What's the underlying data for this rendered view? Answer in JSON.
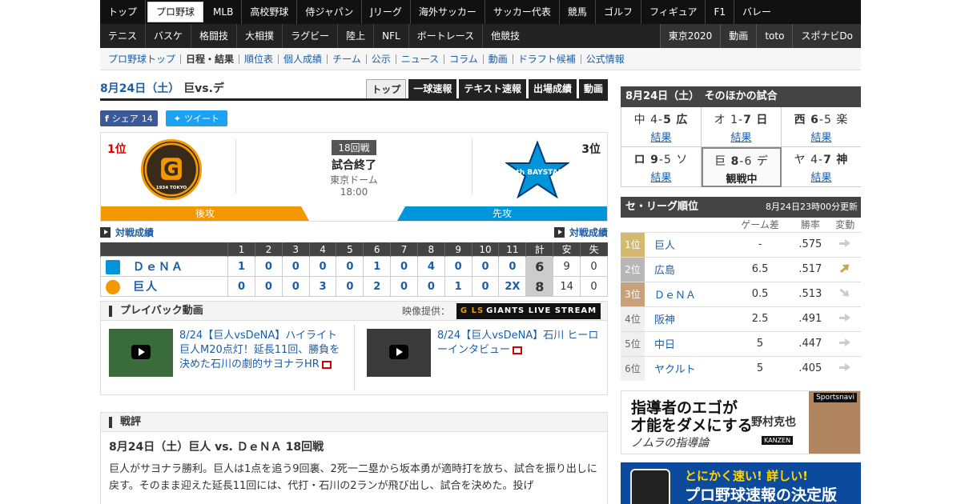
{
  "nav": {
    "row1": [
      "トップ",
      "プロ野球",
      "MLB",
      "高校野球",
      "侍ジャパン",
      "Jリーグ",
      "海外サッカー",
      "サッカー代表",
      "競馬",
      "ゴルフ",
      "フィギュア",
      "F1",
      "バレー"
    ],
    "row1_active": "プロ野球",
    "row2": [
      "テニス",
      "バスケ",
      "格闘技",
      "大相撲",
      "ラグビー",
      "陸上",
      "NFL",
      "ボートレース",
      "他競技"
    ],
    "row2_right": [
      "東京2020",
      "動画",
      "toto",
      "スポナビDo"
    ]
  },
  "subnav": [
    "プロ野球トップ",
    "日程・結果",
    "順位表",
    "個人成績",
    "チーム",
    "公示",
    "ニュース",
    "コラム",
    "動画",
    "ドラフト候補",
    "公式情報"
  ],
  "subnav_current": "日程・結果",
  "game": {
    "date": "8月24日（土）",
    "matchup": "巨vs.デ",
    "tabs": [
      "トップ",
      "一球速報",
      "テキスト速報",
      "出場成績",
      "動画"
    ],
    "share_label": "シェア",
    "share_count": "14",
    "tweet_label": "ツイート",
    "home_rank": "1位",
    "away_rank": "3位",
    "home_logo_text": "G",
    "home_logo_sub": "1934 TOKYO",
    "away_logo_text": "70th BAYSTARS",
    "series": "18回戦",
    "status": "試合終了",
    "venue": "東京ドーム",
    "time": "18:00",
    "home_side": "後攻",
    "away_side": "先攻",
    "h2h_label": "対戦成績"
  },
  "linescore": {
    "innings": [
      "1",
      "2",
      "3",
      "4",
      "5",
      "6",
      "7",
      "8",
      "9",
      "10",
      "11",
      "計",
      "安",
      "失"
    ],
    "rows": [
      {
        "team": "ＤｅＮＡ",
        "scores": [
          "1",
          "0",
          "0",
          "0",
          "0",
          "1",
          "0",
          "4",
          "0",
          "0",
          "0"
        ],
        "total": "6",
        "hits": "9",
        "errors": "0"
      },
      {
        "team": "巨人",
        "scores": [
          "0",
          "0",
          "0",
          "3",
          "0",
          "2",
          "0",
          "0",
          "1",
          "0",
          "2X"
        ],
        "total": "8",
        "hits": "14",
        "errors": "0"
      }
    ]
  },
  "playback": {
    "title": "プレイバック動画",
    "provider_label": "映像提供：",
    "provider": "GIANTS LIVE STREAM",
    "provider_prefix": "G LS",
    "videos": [
      {
        "title": "8/24【巨人vsDeNA】ハイライト 巨人M20点灯！延長11回、勝負を決めた石川の劇的サヨナラHR"
      },
      {
        "title": "8/24【巨人vsDeNA】石川 ヒーローインタビュー"
      }
    ]
  },
  "review": {
    "heading": "戦評",
    "title": "8月24日（土）巨人 vs. ＤｅＮＡ 18回戦",
    "body": "巨人がサヨナラ勝利。巨人は1点を追う9回裏、2死一二塁から坂本勇が適時打を放ち、試合を振り出しに戻す。そのまま迎えた延長11回には、代打・石川の2ランが飛び出し、試合を決めた。投げ"
  },
  "others": {
    "title": "8月24日（土）　そのほかの試合",
    "games": [
      {
        "t1": "中",
        "s1": "4",
        "s2": "5",
        "t2": "広",
        "win": 2,
        "result": "結果",
        "live": false
      },
      {
        "t1": "オ",
        "s1": "1",
        "s2": "7",
        "t2": "日",
        "win": 2,
        "result": "結果",
        "live": false
      },
      {
        "t1": "西",
        "s1": "6",
        "s2": "5",
        "t2": "楽",
        "win": 1,
        "result": "結果",
        "live": false
      },
      {
        "t1": "ロ",
        "s1": "9",
        "s2": "5",
        "t2": "ソ",
        "win": 1,
        "result": "結果",
        "live": false
      },
      {
        "t1": "巨",
        "s1": "8",
        "s2": "6",
        "t2": "デ",
        "win": 1,
        "result": "観戦中",
        "live": true
      },
      {
        "t1": "ヤ",
        "s1": "4",
        "s2": "7",
        "t2": "神",
        "win": 2,
        "result": "結果",
        "live": false
      }
    ]
  },
  "standings": {
    "title": "セ・リーグ順位",
    "updated": "8月24日23時00分更新",
    "headers": [
      "ゲーム差",
      "勝率",
      "変動"
    ],
    "rows": [
      {
        "rank": "1位",
        "team": "巨人",
        "gb": "-",
        "pct": ".575",
        "trend": "flat"
      },
      {
        "rank": "2位",
        "team": "広島",
        "gb": "6.5",
        "pct": ".517",
        "trend": "up"
      },
      {
        "rank": "3位",
        "team": "ＤｅＮＡ",
        "gb": "0.5",
        "pct": ".513",
        "trend": "down"
      },
      {
        "rank": "4位",
        "team": "阪神",
        "gb": "2.5",
        "pct": ".491",
        "trend": "flat"
      },
      {
        "rank": "5位",
        "team": "中日",
        "gb": "5",
        "pct": ".447",
        "trend": "flat"
      },
      {
        "rank": "6位",
        "team": "ヤクルト",
        "gb": "5",
        "pct": ".405",
        "trend": "flat"
      }
    ]
  },
  "ads": {
    "ad1_line1": "指導者のエゴが",
    "ad1_line2": "才能をダメにする",
    "ad1_line3": "ノムラの指導論",
    "ad1_author": "野村克也",
    "ad1_publisher": "KANZEN",
    "ad1_brand": "Sportsnavi",
    "ad2_line1": "とにかく速い! 詳しい!",
    "ad2_line2": "プロ野球速報の決定版"
  },
  "colors": {
    "giants_orange": "#f39800",
    "baystars_blue": "#0095d9",
    "link": "#1a5ea8"
  }
}
